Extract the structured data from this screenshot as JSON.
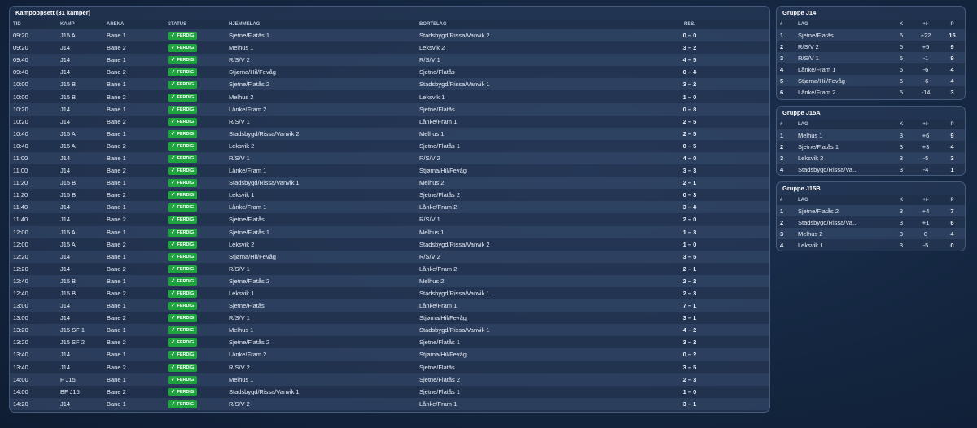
{
  "schedule": {
    "title": "Kampoppsett (31 kamper)",
    "columns": {
      "time": "TID",
      "match": "KAMP",
      "arena": "ARENA",
      "status": "STATUS",
      "home": "HJEMMELAG",
      "away": "BORTELAG",
      "result": "RES."
    },
    "status_check": "✓",
    "matches": [
      {
        "time": "09:20",
        "match": "J15 A",
        "arena": "Bane 1",
        "status": "FERDIG",
        "home": "Sjetne/Flatås 1",
        "away": "Stadsbygd/Rissa/Vanvik 2",
        "result": "0 – 0"
      },
      {
        "time": "09:20",
        "match": "J14",
        "arena": "Bane 2",
        "status": "FERDIG",
        "home": "Melhus 1",
        "away": "Leksvik 2",
        "result": "3 – 2"
      },
      {
        "time": "09:40",
        "match": "J14",
        "arena": "Bane 1",
        "status": "FERDIG",
        "home": "R/S/V 2",
        "away": "R/S/V 1",
        "result": "4 – 5"
      },
      {
        "time": "09:40",
        "match": "J14",
        "arena": "Bane 2",
        "status": "FERDIG",
        "home": "Stjørna/Hil/Fevåg",
        "away": "Sjetne/Flatås",
        "result": "0 – 4"
      },
      {
        "time": "10:00",
        "match": "J15 B",
        "arena": "Bane 1",
        "status": "FERDIG",
        "home": "Sjetne/Flatås 2",
        "away": "Stadsbygd/Rissa/Vanvik 1",
        "result": "3 – 2"
      },
      {
        "time": "10:00",
        "match": "J15 B",
        "arena": "Bane 2",
        "status": "FERDIG",
        "home": "Melhus 2",
        "away": "Leksvik 1",
        "result": "1 – 0"
      },
      {
        "time": "10:20",
        "match": "J14",
        "arena": "Bane 1",
        "status": "FERDIG",
        "home": "Lånke/Fram 2",
        "away": "Sjetne/Flatås",
        "result": "0 – 8"
      },
      {
        "time": "10:20",
        "match": "J14",
        "arena": "Bane 2",
        "status": "FERDIG",
        "home": "R/S/V 1",
        "away": "Lånke/Fram 1",
        "result": "2 – 5"
      },
      {
        "time": "10:40",
        "match": "J15 A",
        "arena": "Bane 1",
        "status": "FERDIG",
        "home": "Stadsbygd/Rissa/Vanvik 2",
        "away": "Melhus 1",
        "result": "2 – 5"
      },
      {
        "time": "10:40",
        "match": "J15 A",
        "arena": "Bane 2",
        "status": "FERDIG",
        "home": "Leksvik 2",
        "away": "Sjetne/Flatås 1",
        "result": "0 – 5"
      },
      {
        "time": "11:00",
        "match": "J14",
        "arena": "Bane 1",
        "status": "FERDIG",
        "home": "R/S/V 1",
        "away": "R/S/V 2",
        "result": "4 – 0"
      },
      {
        "time": "11:00",
        "match": "J14",
        "arena": "Bane 2",
        "status": "FERDIG",
        "home": "Lånke/Fram 1",
        "away": "Stjørna/Hil/Fevåg",
        "result": "3 – 3"
      },
      {
        "time": "11:20",
        "match": "J15 B",
        "arena": "Bane 1",
        "status": "FERDIG",
        "home": "Stadsbygd/Rissa/Vanvik 1",
        "away": "Melhus 2",
        "result": "2 – 1"
      },
      {
        "time": "11:20",
        "match": "J15 B",
        "arena": "Bane 2",
        "status": "FERDIG",
        "home": "Leksvik 1",
        "away": "Sjetne/Flatås 2",
        "result": "0 – 3"
      },
      {
        "time": "11:40",
        "match": "J14",
        "arena": "Bane 1",
        "status": "FERDIG",
        "home": "Lånke/Fram 1",
        "away": "Lånke/Fram 2",
        "result": "3 – 4"
      },
      {
        "time": "11:40",
        "match": "J14",
        "arena": "Bane 2",
        "status": "FERDIG",
        "home": "Sjetne/Flatås",
        "away": "R/S/V 1",
        "result": "2 – 0"
      },
      {
        "time": "12:00",
        "match": "J15 A",
        "arena": "Bane 1",
        "status": "FERDIG",
        "home": "Sjetne/Flatås 1",
        "away": "Melhus 1",
        "result": "1 – 3"
      },
      {
        "time": "12:00",
        "match": "J15 A",
        "arena": "Bane 2",
        "status": "FERDIG",
        "home": "Leksvik 2",
        "away": "Stadsbygd/Rissa/Vanvik 2",
        "result": "1 – 0"
      },
      {
        "time": "12:20",
        "match": "J14",
        "arena": "Bane 1",
        "status": "FERDIG",
        "home": "Stjørna/Hil/Fevåg",
        "away": "R/S/V 2",
        "result": "3 – 5"
      },
      {
        "time": "12:20",
        "match": "J14",
        "arena": "Bane 2",
        "status": "FERDIG",
        "home": "R/S/V 1",
        "away": "Lånke/Fram 2",
        "result": "2 – 1"
      },
      {
        "time": "12:40",
        "match": "J15 B",
        "arena": "Bane 1",
        "status": "FERDIG",
        "home": "Sjetne/Flatås 2",
        "away": "Melhus 2",
        "result": "2 – 2"
      },
      {
        "time": "12:40",
        "match": "J15 B",
        "arena": "Bane 2",
        "status": "FERDIG",
        "home": "Leksvik 1",
        "away": "Stadsbygd/Rissa/Vanvik 1",
        "result": "2 – 3"
      },
      {
        "time": "13:00",
        "match": "J14",
        "arena": "Bane 1",
        "status": "FERDIG",
        "home": "Sjetne/Flatås",
        "away": "Lånke/Fram 1",
        "result": "7 – 1"
      },
      {
        "time": "13:00",
        "match": "J14",
        "arena": "Bane 2",
        "status": "FERDIG",
        "home": "R/S/V 1",
        "away": "Stjørna/Hil/Fevåg",
        "result": "3 – 1"
      },
      {
        "time": "13:20",
        "match": "J15 SF 1",
        "arena": "Bane 1",
        "status": "FERDIG",
        "home": "Melhus 1",
        "away": "Stadsbygd/Rissa/Vanvik 1",
        "result": "4 – 2"
      },
      {
        "time": "13:20",
        "match": "J15 SF 2",
        "arena": "Bane 2",
        "status": "FERDIG",
        "home": "Sjetne/Flatås 2",
        "away": "Sjetne/Flatås 1",
        "result": "3 – 2"
      },
      {
        "time": "13:40",
        "match": "J14",
        "arena": "Bane 1",
        "status": "FERDIG",
        "home": "Lånke/Fram 2",
        "away": "Stjørna/Hil/Fevåg",
        "result": "0 – 2"
      },
      {
        "time": "13:40",
        "match": "J14",
        "arena": "Bane 2",
        "status": "FERDIG",
        "home": "R/S/V 2",
        "away": "Sjetne/Flatås",
        "result": "3 – 5"
      },
      {
        "time": "14:00",
        "match": "F J15",
        "arena": "Bane 1",
        "status": "FERDIG",
        "home": "Melhus 1",
        "away": "Sjetne/Flatås 2",
        "result": "2 – 3"
      },
      {
        "time": "14:00",
        "match": "BF J15",
        "arena": "Bane 2",
        "status": "FERDIG",
        "home": "Stadsbygd/Rissa/Vanvik 1",
        "away": "Sjetne/Flatås 1",
        "result": "1 – 0"
      },
      {
        "time": "14:20",
        "match": "J14",
        "arena": "Bane 1",
        "status": "FERDIG",
        "home": "R/S/V 2",
        "away": "Lånke/Fram 1",
        "result": "3 – 1"
      }
    ]
  },
  "groups": [
    {
      "title": "Gruppe J14",
      "columns": {
        "rank": "#",
        "team": "LAG",
        "played": "K",
        "diff": "+/-",
        "points": "P"
      },
      "rows": [
        {
          "rank": "1",
          "team": "Sjetne/Flatås",
          "played": "5",
          "diff": "+22",
          "points": "15"
        },
        {
          "rank": "2",
          "team": "R/S/V 2",
          "played": "5",
          "diff": "+5",
          "points": "9"
        },
        {
          "rank": "3",
          "team": "R/S/V 1",
          "played": "5",
          "diff": "-1",
          "points": "9"
        },
        {
          "rank": "4",
          "team": "Lånke/Fram 1",
          "played": "5",
          "diff": "-6",
          "points": "4"
        },
        {
          "rank": "5",
          "team": "Stjørna/Hil/Fevåg",
          "played": "5",
          "diff": "-6",
          "points": "4"
        },
        {
          "rank": "6",
          "team": "Lånke/Fram 2",
          "played": "5",
          "diff": "-14",
          "points": "3"
        }
      ]
    },
    {
      "title": "Gruppe J15A",
      "columns": {
        "rank": "#",
        "team": "LAG",
        "played": "K",
        "diff": "+/-",
        "points": "P"
      },
      "rows": [
        {
          "rank": "1",
          "team": "Melhus 1",
          "played": "3",
          "diff": "+6",
          "points": "9"
        },
        {
          "rank": "2",
          "team": "Sjetne/Flatås 1",
          "played": "3",
          "diff": "+3",
          "points": "4"
        },
        {
          "rank": "3",
          "team": "Leksvik 2",
          "played": "3",
          "diff": "-5",
          "points": "3"
        },
        {
          "rank": "4",
          "team": "Stadsbygd/Rissa/Va...",
          "played": "3",
          "diff": "-4",
          "points": "1"
        }
      ]
    },
    {
      "title": "Gruppe J15B",
      "columns": {
        "rank": "#",
        "team": "LAG",
        "played": "K",
        "diff": "+/-",
        "points": "P"
      },
      "rows": [
        {
          "rank": "1",
          "team": "Sjetne/Flatås 2",
          "played": "3",
          "diff": "+4",
          "points": "7"
        },
        {
          "rank": "2",
          "team": "Stadsbygd/Rissa/Va...",
          "played": "3",
          "diff": "+1",
          "points": "6"
        },
        {
          "rank": "3",
          "team": "Melhus 2",
          "played": "3",
          "diff": "0",
          "points": "4"
        },
        {
          "rank": "4",
          "team": "Leksvik 1",
          "played": "3",
          "diff": "-5",
          "points": "0"
        }
      ]
    }
  ]
}
